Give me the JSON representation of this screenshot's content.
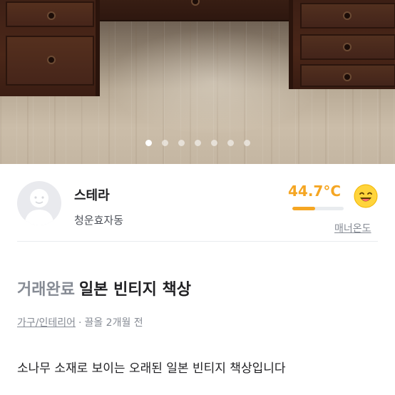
{
  "carousel": {
    "total_images": 7,
    "active_index": 0
  },
  "seller": {
    "name": "스테라",
    "region": "청운효자동",
    "manner_temperature": "44.7°C",
    "manner_temperature_value": 44.7,
    "manner_label": "매너온도",
    "manner_icon": "smile-emoji-icon"
  },
  "article": {
    "status": "거래완료",
    "title": "일본 빈티지 책상",
    "category": "가구/인테리어",
    "separator": "·",
    "time": "끌올 2개월 전",
    "description": "소나무 소재로 보이는 오래된 일본 빈티지 책상입니다"
  },
  "colors": {
    "temperature_accent": "#f5a623",
    "secondary_text": "#868b94",
    "primary_text": "#212124"
  }
}
